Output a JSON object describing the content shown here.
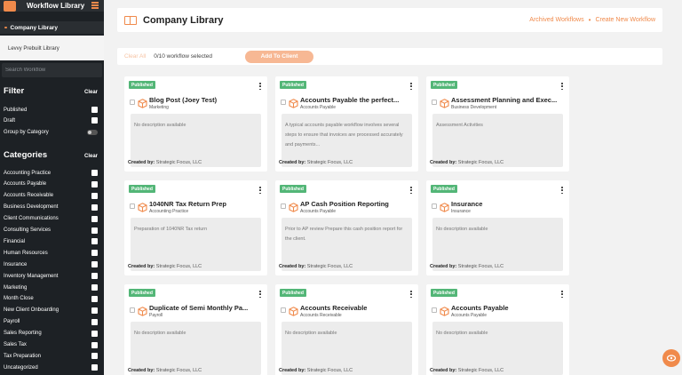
{
  "sidebar": {
    "title": "Workflow Library",
    "active_item": "Company Library",
    "sub_item": "Levvy Prebuilt Library",
    "search_placeholder": "Search Workflow",
    "filter": {
      "heading": "Filter",
      "clear": "Clear",
      "items": [
        "Published",
        "Draft"
      ],
      "group_label": "Group by Category"
    },
    "categories": {
      "heading": "Categories",
      "clear": "Clear",
      "items": [
        "Accounting Practice",
        "Accounts Payable",
        "Accounts Receivable",
        "Business Development",
        "Client Communications",
        "Consulting Services",
        "Financial",
        "Human Resources",
        "Insurance",
        "Inventory Management",
        "Marketing",
        "Month Close",
        "New Client Onboarding",
        "Payroll",
        "Sales Reporting",
        "Sales Tax",
        "Tax Preparation",
        "Uncategorized"
      ]
    }
  },
  "header": {
    "title": "Company Library",
    "archived_link": "Archived Workflows",
    "separator": "•",
    "create_link": "Create New Workflow"
  },
  "selection": {
    "clear_all": "Clear All",
    "count": "0/10 workflow selected",
    "add_button": "Add To Client"
  },
  "card_labels": {
    "created_by_prefix": "Created by:"
  },
  "cards": [
    {
      "status": "Published",
      "title": "Blog Post (Joey Test)",
      "category": "Marketing",
      "description": "No description available",
      "created_by": "Strategic Focus, LLC"
    },
    {
      "status": "Published",
      "title": "Accounts Payable the perfect...",
      "category": "Accounts Payable",
      "description": "A typical accounts payable workflow involves several steps to ensure that invoices are processed accurately and payments...",
      "created_by": "Strategic Focus, LLC"
    },
    {
      "status": "Published",
      "title": "Assessment Planning and Exec...",
      "category": "Business Development",
      "description": "Assessment Activities",
      "created_by": "Strategic Focus, LLC"
    },
    {
      "status": "Published",
      "title": "1040NR Tax Return Prep",
      "category": "Accounting Practice",
      "description": "Preparation of 1040NR Tax return",
      "created_by": "Strategic Focus, LLC"
    },
    {
      "status": "Published",
      "title": "AP Cash Position Reporting",
      "category": "Accounts Payable",
      "description": "Prior to AP review Prepare this cash position report for the client.",
      "created_by": "Strategic Focus, LLC"
    },
    {
      "status": "Published",
      "title": "Insurance",
      "category": "Insurance",
      "description": "No description available",
      "created_by": "Strategic Focus, LLC"
    },
    {
      "status": "Published",
      "title": "Duplicate of Semi Monthly Pa...",
      "category": "Payroll",
      "description": "No description available",
      "created_by": "Strategic Focus, LLC"
    },
    {
      "status": "Published",
      "title": "Accounts Receivable",
      "category": "Accounts Receivable",
      "description": "No description available",
      "created_by": "Strategic Focus, LLC"
    },
    {
      "status": "Published",
      "title": "Accounts Payable",
      "category": "Accounts Payable",
      "description": "No description available",
      "created_by": "Strategic Focus, LLC"
    }
  ],
  "colors": {
    "accent": "#f08a4b",
    "published": "#53b677",
    "sidebar_bg": "#1d2125"
  }
}
